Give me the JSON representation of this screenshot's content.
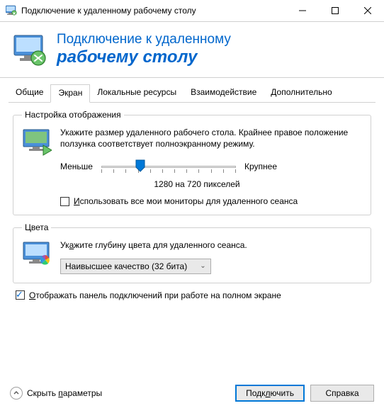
{
  "window": {
    "title": "Подключение к удаленному рабочему столу"
  },
  "banner": {
    "line1": "Подключение к удаленному",
    "line2": "рабочему столу"
  },
  "tabs": [
    {
      "label": "Общие",
      "active": false
    },
    {
      "label": "Экран",
      "active": true
    },
    {
      "label": "Локальные ресурсы",
      "active": false
    },
    {
      "label": "Взаимодействие",
      "active": false
    },
    {
      "label": "Дополнительно",
      "active": false
    }
  ],
  "display": {
    "legend": "Настройка отображения",
    "desc": "Укажите размер удаленного рабочего стола. Крайнее правое положение ползунка соответствует полноэкранному режиму.",
    "slider_min_label": "Меньше",
    "slider_max_label": "Крупнее",
    "resolution_text": "1280 на 720 пикселей",
    "use_all_monitors_key": "И",
    "use_all_monitors_rest": "спользовать все мои мониторы для удаленного сеанса",
    "use_all_monitors_checked": false
  },
  "colors": {
    "legend": "Цвета",
    "desc_pre": "Ук",
    "desc_key": "а",
    "desc_post": "жите глубину цвета для удаленного сеанса.",
    "select_value": "Наивысшее качество (32 бита)"
  },
  "show_bar": {
    "checked": true,
    "key": "О",
    "rest": "тображать панель подключений при работе на полном экране"
  },
  "footer": {
    "hide_params_pre": "Скрыть ",
    "hide_params_key": "п",
    "hide_params_post": "араметры",
    "connect_pre": "Подк",
    "connect_key": "л",
    "connect_post": "ючить",
    "help": "Справка"
  }
}
